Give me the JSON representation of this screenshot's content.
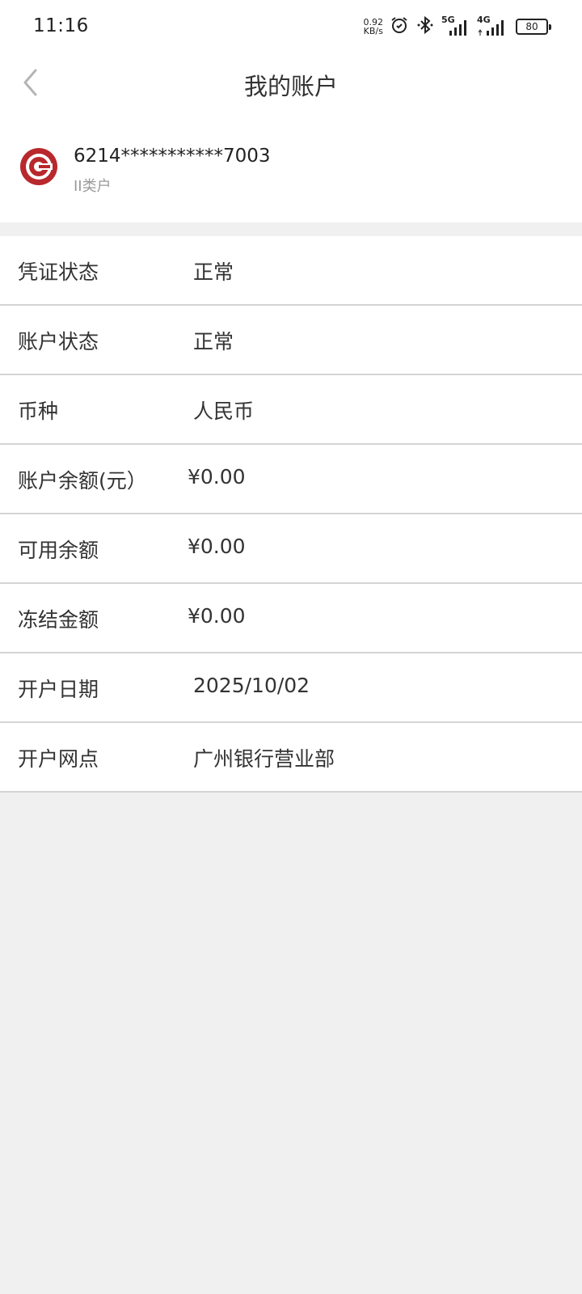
{
  "status_bar": {
    "time": "11:16",
    "net_speed_value": "0.92",
    "net_speed_unit": "KB/s",
    "signal1_label": "5G",
    "signal2_label": "4G",
    "battery": "80",
    "icons": [
      "alarm-icon",
      "bluetooth-icon",
      "signal-icon",
      "battery-icon"
    ]
  },
  "nav": {
    "title": "我的账户",
    "back_icon": "chevron-left-icon"
  },
  "account": {
    "number": "6214***********7003",
    "type": "II类户",
    "logo_color": "#b8282c"
  },
  "details": [
    {
      "label": "凭证状态",
      "value": "正常"
    },
    {
      "label": "账户状态",
      "value": "正常"
    },
    {
      "label": "币种",
      "value": "人民币"
    },
    {
      "label": "账户余额(元）",
      "value": "¥0.00"
    },
    {
      "label": "可用余额",
      "value": "¥0.00"
    },
    {
      "label": "冻结金额",
      "value": "¥0.00"
    },
    {
      "label": "开户日期",
      "value": "2025/10/02"
    },
    {
      "label": "开户网点",
      "value": "广州银行营业部"
    }
  ]
}
